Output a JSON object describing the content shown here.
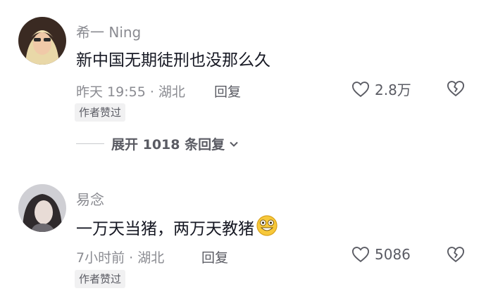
{
  "comments": [
    {
      "username": "希一 Ning",
      "text": "新中国无期徒刑也没那么久",
      "time_location": "昨天 19:55 · 湖北",
      "reply_label": "回复",
      "like_count": "2.8万",
      "badge": "作者赞过",
      "expand_label": "展开 1018 条回复"
    },
    {
      "username": "易念",
      "text": "一万天当猪，两万天教猪",
      "emoji": "grinning-face-emoji",
      "time_location": "7小时前 · 湖北",
      "reply_label": "回复",
      "like_count": "5086",
      "badge": "作者赞过"
    }
  ],
  "colors": {
    "secondary_text": "#8a8b91",
    "primary_text": "#161823",
    "badge_bg": "#f1f1f2"
  }
}
